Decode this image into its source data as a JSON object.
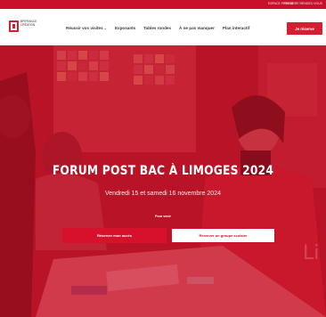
{
  "topbar": {
    "links": [
      "ESPACE PRESSE",
      "PRENDRE RENDEZ-VOUS"
    ]
  },
  "header": {
    "logo_text": "BPIFRANCE CRÉATION",
    "nav": [
      {
        "label": "Réussir vos visites",
        "has_dropdown": true
      },
      {
        "label": "Exposants",
        "has_dropdown": false
      },
      {
        "label": "Tables rondes",
        "has_dropdown": false
      },
      {
        "label": "À ne pas manquer",
        "has_dropdown": false
      },
      {
        "label": "Plan interactif",
        "has_dropdown": false
      }
    ],
    "cta": "Je réserve"
  },
  "hero": {
    "title": "FORUM POST BAC À LIMOGES 2024",
    "dates": "Vendredi 15 et samedi 16 novembre 2024",
    "subtitle": "Pour venir",
    "primary_button": "Réserver mon accès",
    "secondary_button": "Réserver un groupe scolaire"
  },
  "colors": {
    "brand_red": "#d21f32",
    "hero_tint": "#c81226",
    "white": "#ffffff"
  }
}
